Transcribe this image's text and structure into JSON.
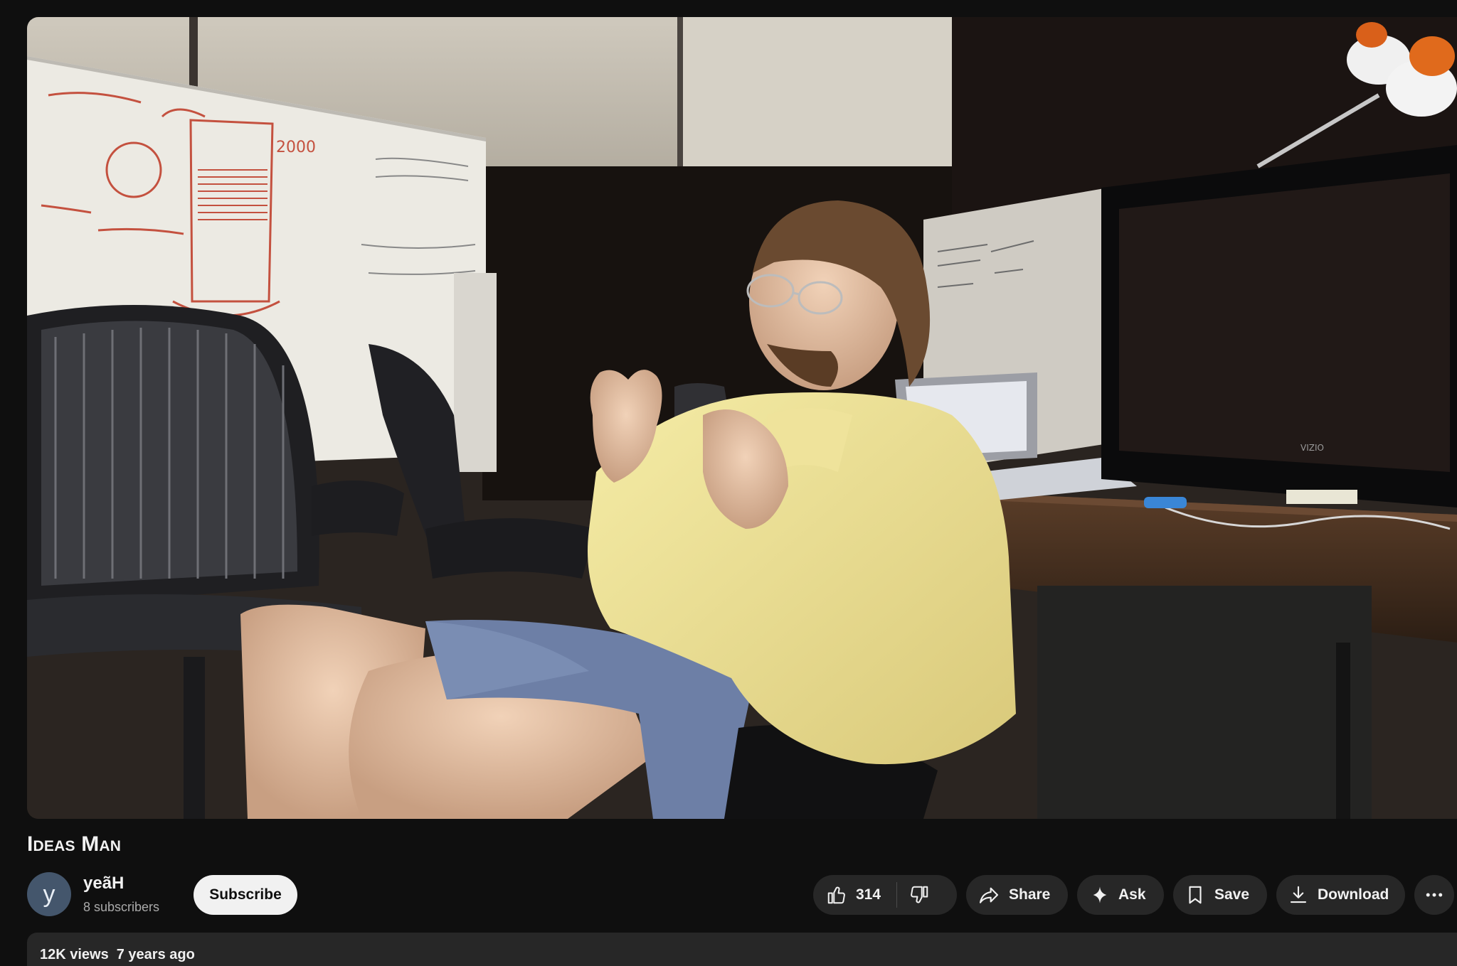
{
  "video": {
    "title": "Ideas Man",
    "scene_text": {
      "whiteboard_number": "2000",
      "tv_brand": "VIZIO"
    }
  },
  "channel": {
    "avatar_letter": "y",
    "name": "yeãH",
    "subscribers": "8 subscribers"
  },
  "actions": {
    "subscribe_label": "Subscribe",
    "like_count": "314",
    "share_label": "Share",
    "ask_label": "Ask",
    "save_label": "Save",
    "download_label": "Download"
  },
  "description": {
    "views": "12K views",
    "age": "7 years ago"
  },
  "icons": {
    "like": "thumbs-up-icon",
    "dislike": "thumbs-down-icon",
    "share": "share-arrow-icon",
    "ask": "sparkle-icon",
    "save": "bookmark-icon",
    "download": "download-icon",
    "more": "more-horizontal-icon"
  },
  "colors": {
    "background": "#0f0f0f",
    "pill": "#272727",
    "subscribe_bg": "#f1f1f1",
    "avatar_bg": "#44566c",
    "secondary_text": "#aaaaaa"
  }
}
